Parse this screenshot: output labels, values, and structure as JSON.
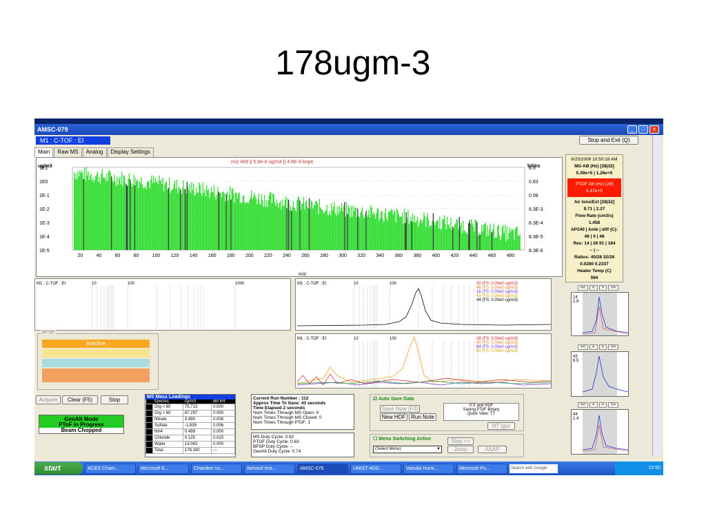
{
  "slide_title": "178ugm-3",
  "window": {
    "app_caption": "AMSC-079",
    "mode": "M1 : C-TOF : EI",
    "stop_exit_label": "Stop and Exit (Q)"
  },
  "tabs": [
    {
      "label": "Main"
    },
    {
      "label": "Raw MS"
    },
    {
      "label": "Analog"
    },
    {
      "label": "Display Settings"
    }
  ],
  "main_chart": {
    "header": "m/z 469 || 5.6e-4 ug/m3 || 4.6E-4 bnpe",
    "left_unit": "ug/m3",
    "right_unit": "bit/ns",
    "left_ticks": [
      "1E1",
      "1E0",
      "1E-1",
      "1E-2",
      "1E-3",
      "1E-4",
      "1E-5"
    ],
    "right_ticks": [
      "8.3",
      "0.83",
      "0.08",
      "8.3E-3",
      "8.3E-4",
      "8.3E-5",
      "8.3E-6"
    ],
    "x_ticks": [
      "20",
      "40",
      "60",
      "80",
      "100",
      "120",
      "140",
      "160",
      "180",
      "200",
      "220",
      "240",
      "260",
      "280",
      "300",
      "320",
      "340",
      "360",
      "380",
      "400",
      "420",
      "440",
      "460",
      "480"
    ],
    "xlabel": "m/z"
  },
  "chart_data": {
    "type": "bar",
    "xlabel": "m/z",
    "ylabel": "ug/m3",
    "yscale": "log",
    "xlim": [
      10,
      495
    ],
    "ylim": [
      1e-05,
      10
    ],
    "series": [
      {
        "name": "",
        "color": "#33dd33"
      }
    ],
    "envelope_mz": [
      12,
      40,
      80,
      120,
      160,
      200,
      240,
      280,
      320,
      360,
      400,
      440,
      480
    ],
    "envelope_value": [
      3,
      1.5,
      0.8,
      0.3,
      0.12,
      0.05,
      0.02,
      0.008,
      0.004,
      0.002,
      0.0008,
      0.0003,
      0.0001
    ]
  },
  "panels": {
    "left_mid_label": "M1 : C-TOF : EI",
    "left_mid_ticks": [
      "10",
      "100",
      "1000"
    ],
    "pt1_label": "M1 : C-TOF : EI",
    "pt1_ticks": [
      "10",
      "100"
    ],
    "pt1_legend": [
      "30 (FS: 0.00e0 ug/m3)",
      "46 (FS: 0.00e0 ug/m3)",
      "16 (FS: 0.00e0 ug/m3)",
      "43 (FS: 0.00e0 ug/m3)",
      "44 (FS: 0.00e0 ug/m3)"
    ],
    "pt2_label": "M1 : C-TOF : EI",
    "pt2_ticks": [
      "10",
      "100"
    ],
    "pt2_legend": [
      "28 (FS: 0.00e0 ug/m3)",
      "40 (FS: 0.00e0 ug/m3)",
      "64 (FS: 0.00e0 ug/m3)",
      "81 (FS: 0.00e0 ug/m3)"
    ]
  },
  "bfsp": {
    "label": "BFSP",
    "status": "Inactive",
    "colors": [
      "#f8a820",
      "#f8e48c",
      "#a8dce0",
      "#f4a060"
    ]
  },
  "controls": {
    "acquire": "Acquire",
    "clear": "Clear (F5)",
    "stop": "Stop",
    "mode_lines": [
      "GenAlt Mode",
      "PToF in Progress",
      "Beam Chopped"
    ]
  },
  "ms_loadings": {
    "title": "MS Mass Loadings",
    "headers": [
      "Species",
      "ug/m3",
      "det lmt"
    ],
    "rows": [
      {
        "species": "Org < 60",
        "value": "75.713",
        "det": "0.000"
      },
      {
        "species": "Org > 60",
        "value": "67.297",
        "det": "0.000"
      },
      {
        "species": "Nitrate",
        "value": "3.490",
        "det": "0.006"
      },
      {
        "species": "Sulfate",
        "value": "-1.839",
        "det": "0.006"
      },
      {
        "species": "NH4",
        "value": "0.499",
        "det": "0.000"
      },
      {
        "species": "Chloride",
        "value": "0.125",
        "det": "0.015"
      },
      {
        "species": "Water",
        "value": "13.043",
        "det": "0.000"
      },
      {
        "species": "Total",
        "value": "178.330",
        "det": "---"
      }
    ]
  },
  "run_info": [
    "Current Run Number : 112",
    "Approx Time To Save: 43 seconds",
    "Time Elapsed 2 seconds",
    "Num Times Through MS Open: 0",
    "Num Times Through MS Closed: 0",
    "Num Times Through PToF: 1"
  ],
  "duty_info": [
    "MS Duty Cycle: 0.92",
    "PTOF Duty Cycle: 0.63",
    "BFSP Duty Cycle: --",
    "GenAlt Duty Cycle: 0.74"
  ],
  "save": {
    "auto_label": "Auto Save Data",
    "save_now": "Save Now (F3)",
    "new_hdf": "New HDF",
    "run_note": "Run Note",
    "itx_lines": [
      "ITX and HDF",
      "Saving PToF Binary",
      "Quick View:  TT"
    ],
    "rt_igor": "RT Igor",
    "menu_switching": "Menu Switching Active",
    "select_menu": "(Select Menu)",
    "step": "Step >>",
    "jump": "Jump",
    "asap": "ASAP"
  },
  "side": {
    "datetime": "6/25/2008 10:50:18 AM",
    "msab_label": "MS-AB (Hz) [28|32]",
    "msab_value": "5.39e+5 | 1.26e+5",
    "ptof_label": "PTOF AB (Hz) [28]",
    "ptof_value": "6.37e+5",
    "airions_label": "Air Ions/Ext [28|32]",
    "airions_value": "9.71 | 2.27",
    "flow_label": "Flow Rate (cm3/s)",
    "flow_value": "1.458",
    "ap240_label": "AP240 | Amb | diff (C):",
    "ap240_value": "48 | 0 | 48",
    "res_label": "Res: 14 | 28   91 | 184",
    "res_value": "-- | --",
    "ratios_label": "Ratios: 40/28  32/28",
    "ratios_value": "0.0280  0.2337",
    "heater_label": "Heater Temp (C)",
    "heater_value": "594"
  },
  "minis": [
    {
      "nav": [
        "<<",
        "<",
        ">",
        ">>"
      ],
      "n1": "14",
      "n2": "1.9"
    },
    {
      "nav": [
        "<<",
        "<",
        ">",
        ">>"
      ],
      "n1": "43",
      "n2": "6.5"
    },
    {
      "nav": [
        "<<",
        "<",
        ">",
        ">>"
      ],
      "n1": "44",
      "n2": "1.4"
    }
  ],
  "taskbar": {
    "start": "start",
    "items": [
      "ACES Cham...",
      "Microsoft E...",
      "Chamber co...",
      "Aerosol Inst...",
      "AMSC-079",
      "UMIST-4DD...",
      "Vaisala Humi...",
      "Microsoft Po..."
    ],
    "search": "Search with Google",
    "clock": "10:50"
  }
}
